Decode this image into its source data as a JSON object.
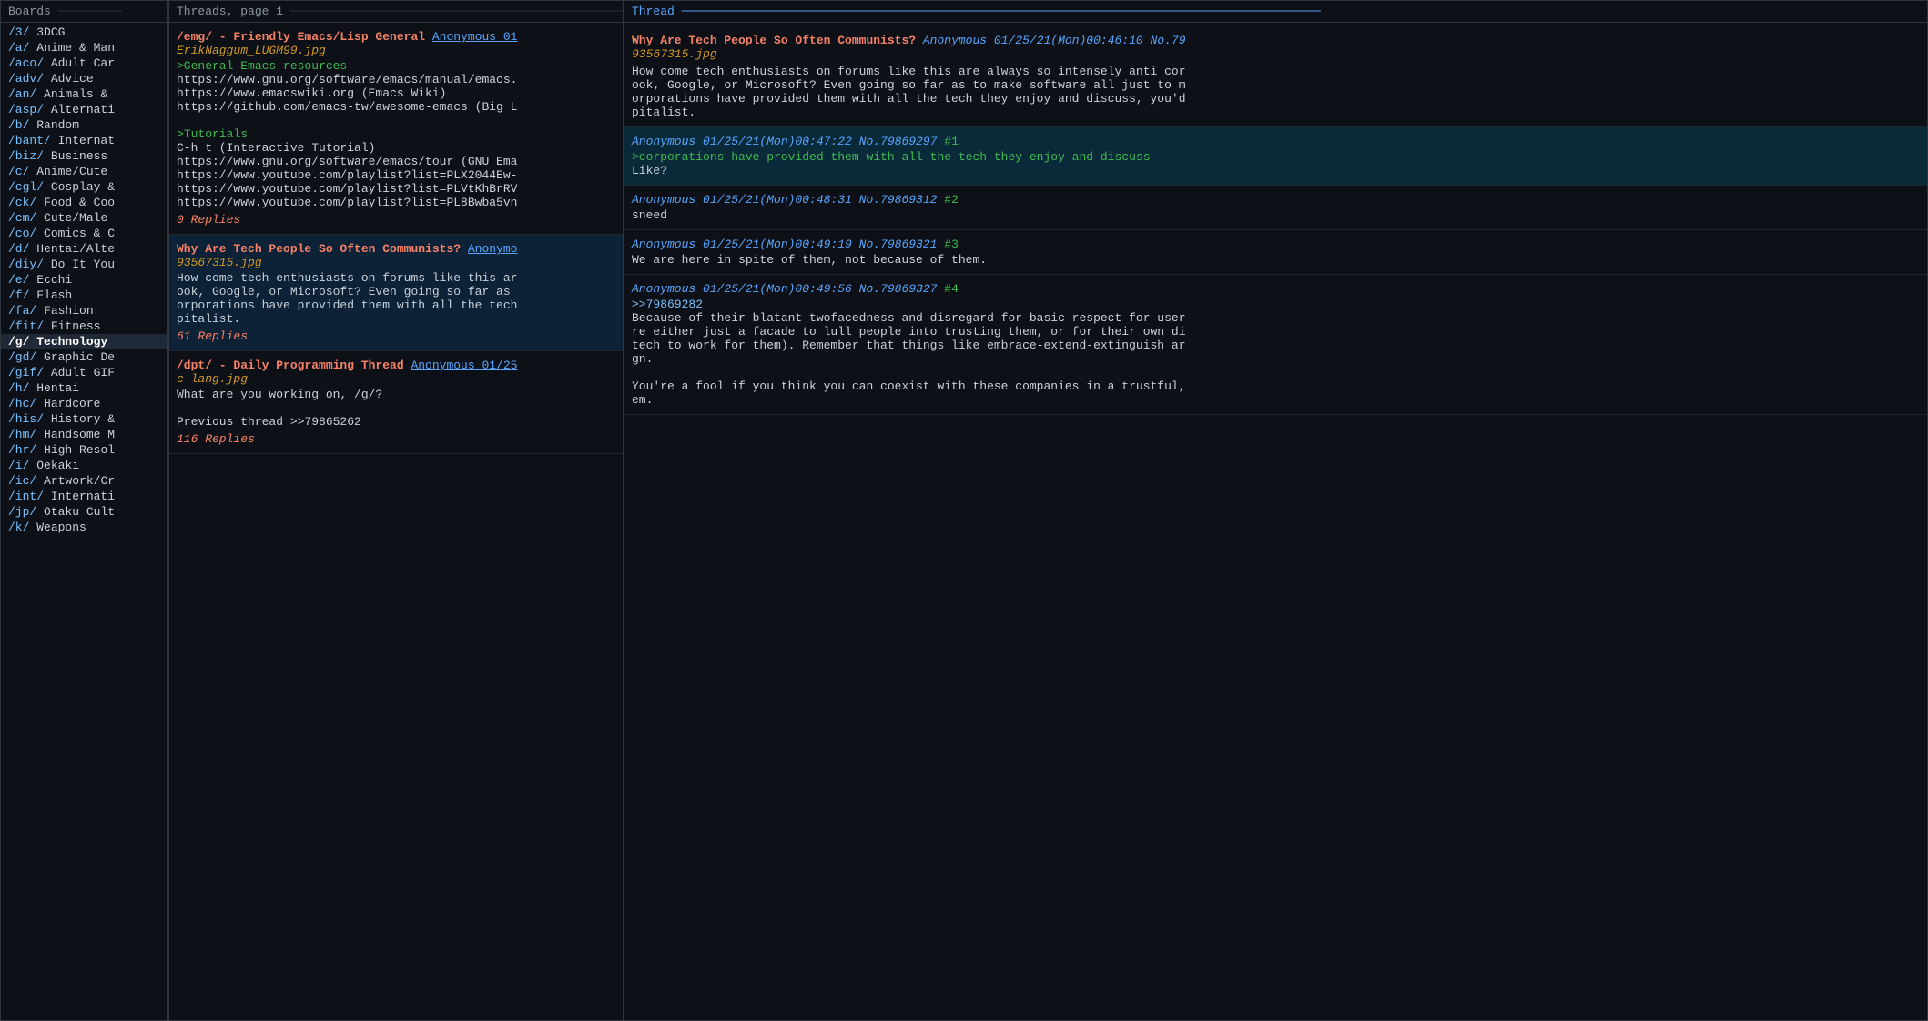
{
  "boards": {
    "header": "Boards",
    "items": [
      {
        "slug": "/3/",
        "name": "3DCG"
      },
      {
        "slug": "/a/",
        "name": "Anime & Man"
      },
      {
        "slug": "/aco/",
        "name": "Adult Car"
      },
      {
        "slug": "/adv/",
        "name": "Advice"
      },
      {
        "slug": "/an/",
        "name": "Animals &"
      },
      {
        "slug": "/asp/",
        "name": "Alternati"
      },
      {
        "slug": "/b/",
        "name": "Random"
      },
      {
        "slug": "/bant/",
        "name": "Internat"
      },
      {
        "slug": "/biz/",
        "name": "Business"
      },
      {
        "slug": "/c/",
        "name": "Anime/Cute"
      },
      {
        "slug": "/cgl/",
        "name": "Cosplay &"
      },
      {
        "slug": "/ck/",
        "name": "Food & Coo"
      },
      {
        "slug": "/cm/",
        "name": "Cute/Male"
      },
      {
        "slug": "/co/",
        "name": "Comics & C"
      },
      {
        "slug": "/d/",
        "name": "Hentai/Alte"
      },
      {
        "slug": "/diy/",
        "name": "Do It You"
      },
      {
        "slug": "/e/",
        "name": "Ecchi"
      },
      {
        "slug": "/f/",
        "name": "Flash"
      },
      {
        "slug": "/fa/",
        "name": "Fashion"
      },
      {
        "slug": "/fit/",
        "name": "Fitness"
      },
      {
        "slug": "/g/",
        "name": "Technology",
        "active": true
      },
      {
        "slug": "/gd/",
        "name": "Graphic De"
      },
      {
        "slug": "/gif/",
        "name": "Adult GIF"
      },
      {
        "slug": "/h/",
        "name": "Hentai"
      },
      {
        "slug": "/hc/",
        "name": "Hardcore"
      },
      {
        "slug": "/his/",
        "name": "History &"
      },
      {
        "slug": "/hm/",
        "name": "Handsome M"
      },
      {
        "slug": "/hr/",
        "name": "High Resol"
      },
      {
        "slug": "/i/",
        "name": "Oekaki"
      },
      {
        "slug": "/ic/",
        "name": "Artwork/Cr"
      },
      {
        "slug": "/int/",
        "name": "Internati"
      },
      {
        "slug": "/jp/",
        "name": "Otaku Cult"
      },
      {
        "slug": "/k/",
        "name": "Weapons"
      }
    ]
  },
  "threads": {
    "header": "Threads, page 1",
    "items": [
      {
        "id": "emg",
        "title": "/emg/ - Friendly Emacs/Lisp General",
        "meta": "Anonymous 01",
        "file": "ErikNaggum_LUGM99.jpg",
        "highlighted": false,
        "body_lines": [
          ">General Emacs resources",
          "https://www.gnu.org/software/emacs/manual/emacs.",
          "https://www.emacswiki.org (Emacs Wiki)",
          "https://github.com/emacs-tw/awesome-emacs (Big L",
          "",
          ">Tutorials",
          "C-h t (Interactive Tutorial)",
          "https://www.gnu.org/software/emacs/tour (GNU Ema",
          "https://www.youtube.com/playlist?list=PLX2044Ew-",
          "https://www.youtube.com/playlist?list=PLVtKhBrRV",
          "https://www.youtube.com/playlist?list=PL8Bwba5vn"
        ],
        "replies": "0 Replies"
      },
      {
        "id": "tech-communists",
        "title": "Why Are Tech People So Often Communists?",
        "meta": "Anonymo",
        "file": "93567315.jpg",
        "highlighted": true,
        "body_lines": [
          "How come tech enthusiasts on forums like this ar",
          "ook, Google, or Microsoft? Even going so far as",
          "orporations have provided them with all the tech",
          "pitalist."
        ],
        "replies": "61 Replies"
      },
      {
        "id": "dpt",
        "title": "/dpt/ - Daily Programming Thread",
        "meta": "Anonymous 01/25",
        "file": "c-lang.jpg",
        "highlighted": false,
        "body_lines": [
          "What are you working on, /g/?",
          "",
          "Previous thread >>79865262"
        ],
        "replies": "116 Replies"
      }
    ]
  },
  "thread": {
    "header": "Thread",
    "op": {
      "title": "Why Are Tech People So Often Communists?",
      "meta": "Anonymous 01/25/21(Mon)00:46:10 No.79",
      "file": "93567315.jpg",
      "body": "How come tech enthusiasts on forums like this are always so intensely anti cor\nook, Google, or Microsoft? Even going so far as to make software all just to m\norporations have provided them with all the tech they enjoy and discuss, you'd\npitalist."
    },
    "replies": [
      {
        "id": "r1",
        "meta": "Anonymous 01/25/21(Mon)00:47:22 No.79869297",
        "num": "#1",
        "highlighted": true,
        "body_lines": [
          ">corporations have provided them with all the tech they enjoy and discuss",
          "Like?"
        ],
        "quote_line": 0
      },
      {
        "id": "r2",
        "meta": "Anonymous 01/25/21(Mon)00:48:31 No.79869312",
        "num": "#2",
        "highlighted": false,
        "body_lines": [
          "sneed"
        ],
        "quote_line": -1
      },
      {
        "id": "r3",
        "meta": "Anonymous 01/25/21(Mon)00:49:19 No.79869321",
        "num": "#3",
        "highlighted": false,
        "body_lines": [
          "We are here in spite of them, not because of them."
        ],
        "quote_line": -1
      },
      {
        "id": "r4",
        "meta": "Anonymous 01/25/21(Mon)00:49:56 No.79869327",
        "num": "#4",
        "highlighted": false,
        "body_lines": [
          ">>79869282",
          "Because of their blatant twofacedness and disregard for basic respect for user",
          "re either just a facade to lull people into trusting them, or for their own di",
          "tech to work for them). Remember that things like embrace-extend-extinguish ar",
          "gn.",
          "",
          "You're a fool if you think you can coexist with these companies in a trustful,",
          "em."
        ],
        "quote_line": 0,
        "ref_line": 0
      }
    ]
  }
}
